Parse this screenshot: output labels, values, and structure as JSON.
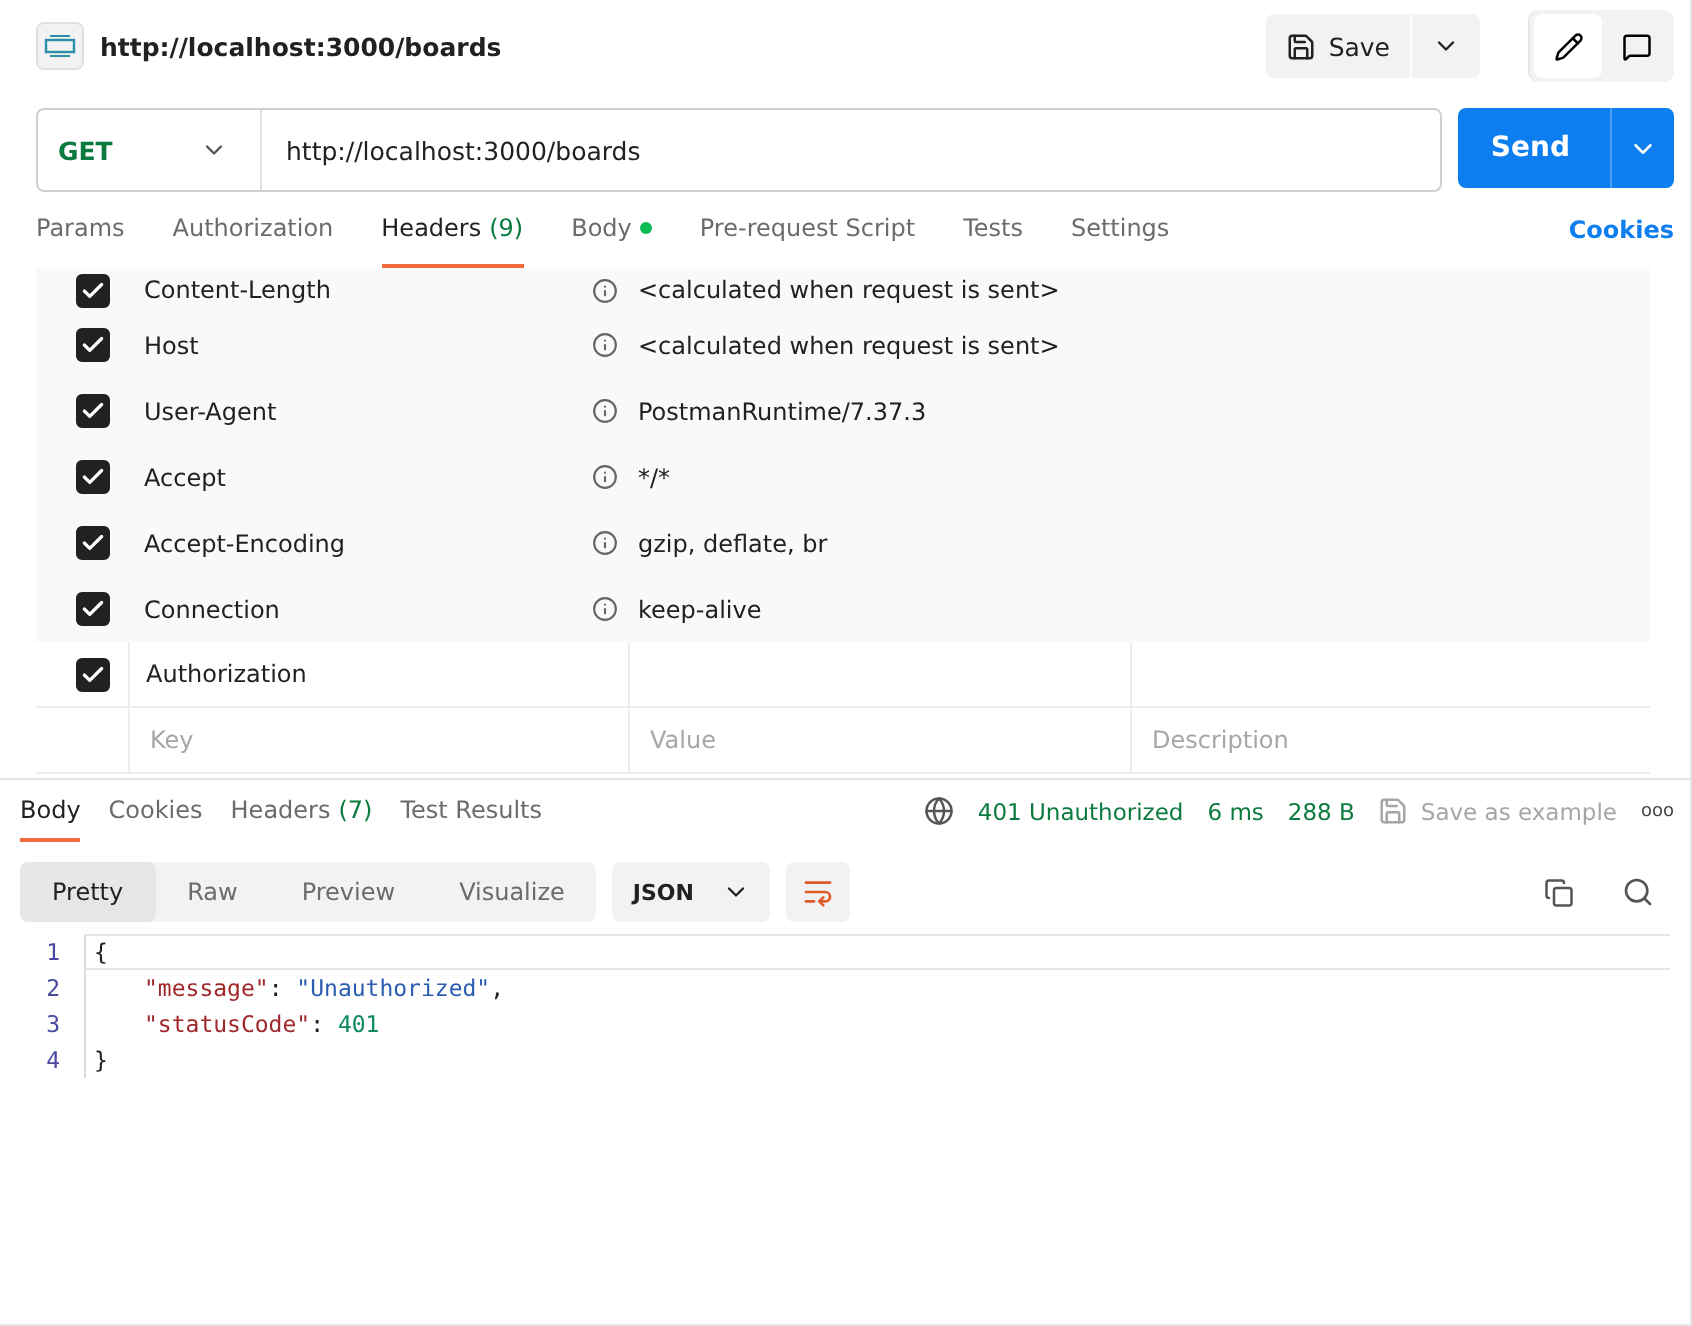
{
  "request": {
    "title": "http://localhost:3000/boards",
    "save_label": "Save",
    "method": "GET",
    "url": "http://localhost:3000/boards",
    "send_label": "Send"
  },
  "request_tabs": [
    {
      "label": "Params",
      "dot": false,
      "selected": false
    },
    {
      "label": "Authorization",
      "dot": false,
      "selected": false
    },
    {
      "label": "Headers",
      "count": "(9)",
      "dot": false,
      "selected": true
    },
    {
      "label": "Body",
      "dot": true,
      "selected": false
    },
    {
      "label": "Pre-request Script",
      "dot": false,
      "selected": false
    },
    {
      "label": "Tests",
      "dot": false,
      "selected": false
    },
    {
      "label": "Settings",
      "dot": false,
      "selected": false
    }
  ],
  "cookies_link": "Cookies",
  "headers": [
    {
      "key": "Content-Length",
      "value": "<calculated when request is sent>",
      "checked": true,
      "auto": true
    },
    {
      "key": "Host",
      "value": "<calculated when request is sent>",
      "checked": true,
      "auto": true
    },
    {
      "key": "User-Agent",
      "value": "PostmanRuntime/7.37.3",
      "checked": true,
      "auto": true
    },
    {
      "key": "Accept",
      "value": "*/*",
      "checked": true,
      "auto": true
    },
    {
      "key": "Accept-Encoding",
      "value": "gzip, deflate, br",
      "checked": true,
      "auto": true
    },
    {
      "key": "Connection",
      "value": "keep-alive",
      "checked": true,
      "auto": true
    },
    {
      "key": "Authorization",
      "checked": true,
      "auto": false
    }
  ],
  "new_header": {
    "key_placeholder": "Key",
    "value_placeholder": "Value",
    "description_placeholder": "Description"
  },
  "response_tabs": [
    {
      "label": "Body",
      "selected": true
    },
    {
      "label": "Cookies",
      "selected": false
    },
    {
      "label": "Headers",
      "count": "(7)",
      "selected": false
    },
    {
      "label": "Test Results",
      "selected": false
    }
  ],
  "response_status": {
    "status": "401 Unauthorized",
    "time": "6 ms",
    "size": "288 B",
    "save_example": "Save as example",
    "more": "ooo"
  },
  "view_modes": [
    {
      "label": "Pretty",
      "selected": true
    },
    {
      "label": "Raw",
      "selected": false
    },
    {
      "label": "Preview",
      "selected": false
    },
    {
      "label": "Visualize",
      "selected": false
    }
  ],
  "format": "JSON",
  "code": [
    {
      "number": "1",
      "indented": false,
      "tokens": [
        {
          "kind": "punct",
          "text": "{"
        }
      ]
    },
    {
      "number": "2",
      "indented": true,
      "tokens": [
        {
          "kind": "key",
          "text": "\"message\""
        },
        {
          "kind": "punct",
          "text": ": "
        },
        {
          "kind": "string",
          "text": "\"Unauthorized\""
        },
        {
          "kind": "punct",
          "text": ","
        }
      ]
    },
    {
      "number": "3",
      "indented": true,
      "tokens": [
        {
          "kind": "key",
          "text": "\"statusCode\""
        },
        {
          "kind": "punct",
          "text": ": "
        },
        {
          "kind": "number",
          "text": "401"
        }
      ]
    },
    {
      "number": "4",
      "indented": false,
      "tokens": [
        {
          "kind": "punct",
          "text": "}"
        }
      ]
    }
  ]
}
